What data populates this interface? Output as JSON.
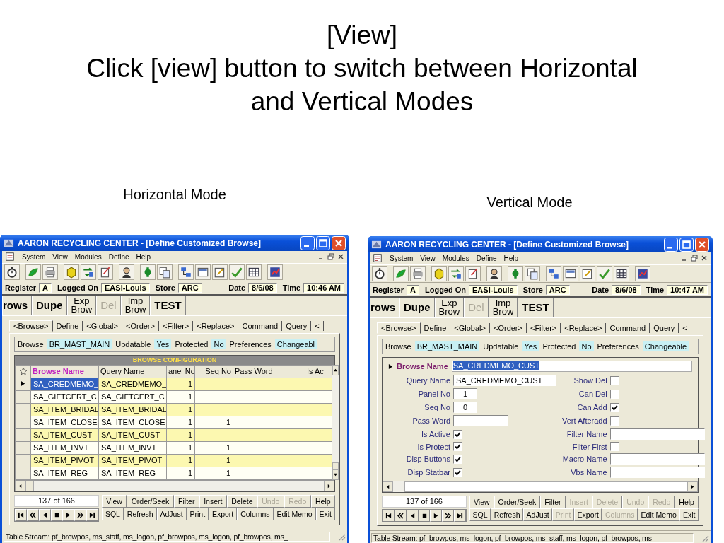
{
  "slide": {
    "title_lines": [
      "[View]",
      "Click [view] button to switch between Horizontal and Vertical Modes"
    ]
  },
  "panels": [
    {
      "caption": "Horizontal Mode",
      "kind": "grid",
      "window": {
        "title": "AARON RECYCLING CENTER - [Define Customized Browse]",
        "menu": [
          "System",
          "View",
          "Modules",
          "Define",
          "Help"
        ],
        "info": [
          {
            "label": "Register",
            "value": "A"
          },
          {
            "label": "Logged On",
            "value": "EASI-Louis"
          },
          {
            "label": "Store",
            "value": "ARC"
          },
          {
            "label": "Date",
            "value": "8/6/08"
          },
          {
            "label": "Time",
            "value": "10:46 AM"
          }
        ],
        "big_buttons": [
          {
            "lines": [
              "rows"
            ],
            "disabled": false
          },
          {
            "lines": [
              "Dupe"
            ],
            "disabled": false
          },
          {
            "lines": [
              "Exp",
              "Brow"
            ],
            "disabled": false
          },
          {
            "lines": [
              "Del"
            ],
            "disabled": true
          },
          {
            "lines": [
              "Imp",
              "Brow"
            ],
            "disabled": false
          },
          {
            "lines": [
              "TEST"
            ],
            "disabled": false
          }
        ],
        "tabs": [
          {
            "label": "<Browse>",
            "selected": true
          },
          {
            "label": "Define",
            "selected": false
          },
          {
            "label": "<Global>",
            "selected": false
          },
          {
            "label": "<Order>",
            "selected": false
          },
          {
            "label": "<Filter>",
            "selected": false
          },
          {
            "label": "<Replace>",
            "selected": false
          },
          {
            "label": "Command",
            "selected": false
          },
          {
            "label": "Query",
            "selected": false
          },
          {
            "label": "<",
            "selected": false
          }
        ],
        "browse_row": [
          {
            "label": "Browse",
            "value": "BR_MAST_MAIN"
          },
          {
            "label": "Updatable",
            "value": "Yes"
          },
          {
            "label": "Protected",
            "value": "No"
          },
          {
            "label": "Preferences",
            "value": "Changeabl"
          }
        ],
        "grid": {
          "band": "BROWSE CONFIGURATION",
          "columns": [
            "Browse Name",
            "Query Name",
            "anel No",
            "Seq No",
            "Pass Word",
            "Is Ac"
          ],
          "rows": [
            {
              "browse_name": "SA_CREDMEMO_",
              "query_name": "SA_CREDMEMO_",
              "panel_no": "1",
              "selected": true
            },
            {
              "browse_name": "SA_GIFTCERT_C",
              "query_name": "SA_GIFTCERT_C",
              "panel_no": "1",
              "selected": false
            },
            {
              "browse_name": "SA_ITEM_BRIDAL",
              "query_name": "SA_ITEM_BRIDAL",
              "panel_no": "1",
              "selected": false
            },
            {
              "browse_name": "SA_ITEM_CLOSE",
              "query_name": "SA_ITEM_CLOSE",
              "panel_no": "1",
              "seq_no": "1",
              "selected": false
            },
            {
              "browse_name": "SA_ITEM_CUST",
              "query_name": "SA_ITEM_CUST",
              "panel_no": "1",
              "selected": false
            },
            {
              "browse_name": "SA_ITEM_INVT",
              "query_name": "SA_ITEM_INVT",
              "panel_no": "1",
              "seq_no": "1",
              "selected": false
            },
            {
              "browse_name": "SA_ITEM_PIVOT",
              "query_name": "SA_ITEM_PIVOT",
              "panel_no": "1",
              "seq_no": "1",
              "selected": false
            },
            {
              "browse_name": "SA_ITEM_REG",
              "query_name": "SA_ITEM_REG",
              "panel_no": "1",
              "seq_no": "1",
              "selected": false
            }
          ]
        },
        "record_count": "137 of 166",
        "button_rows": [
          [
            {
              "label": "View",
              "disabled": false
            },
            {
              "label": "Order/Seek",
              "disabled": false
            },
            {
              "label": "Filter",
              "disabled": false
            },
            {
              "label": "Insert",
              "disabled": false
            },
            {
              "label": "Delete",
              "disabled": false
            },
            {
              "label": "Undo",
              "disabled": true
            },
            {
              "label": "Redo",
              "disabled": true
            },
            {
              "label": "Help",
              "disabled": false
            }
          ],
          [
            {
              "label": "SQL",
              "disabled": false
            },
            {
              "label": "Refresh",
              "disabled": false
            },
            {
              "label": "AdJust",
              "disabled": false
            },
            {
              "label": "Print",
              "disabled": false
            },
            {
              "label": "Export",
              "disabled": false
            },
            {
              "label": "Columns",
              "disabled": false
            },
            {
              "label": "Edit Memo",
              "disabled": false
            },
            {
              "label": "Exit",
              "disabled": false
            }
          ]
        ],
        "status": "Table Stream: pf_browpos, ms_staff, ms_logon, pf_browpos, ms_logon, pf_browpos, ms_"
      }
    },
    {
      "caption": "Vertical Mode",
      "kind": "form",
      "window": {
        "title": "AARON RECYCLING CENTER - [Define Customized Browse]",
        "menu": [
          "System",
          "View",
          "Modules",
          "Define",
          "Help"
        ],
        "info": [
          {
            "label": "Register",
            "value": "A"
          },
          {
            "label": "Logged On",
            "value": "EASI-Louis"
          },
          {
            "label": "Store",
            "value": "ARC"
          },
          {
            "label": "Date",
            "value": "8/6/08"
          },
          {
            "label": "Time",
            "value": "10:47 AM"
          }
        ],
        "big_buttons": [
          {
            "lines": [
              "rows"
            ],
            "disabled": false
          },
          {
            "lines": [
              "Dupe"
            ],
            "disabled": false
          },
          {
            "lines": [
              "Exp",
              "Brow"
            ],
            "disabled": false
          },
          {
            "lines": [
              "Del"
            ],
            "disabled": true
          },
          {
            "lines": [
              "Imp",
              "Brow"
            ],
            "disabled": false
          },
          {
            "lines": [
              "TEST"
            ],
            "disabled": false
          }
        ],
        "tabs": [
          {
            "label": "<Browse>",
            "selected": true
          },
          {
            "label": "Define",
            "selected": false
          },
          {
            "label": "<Global>",
            "selected": false
          },
          {
            "label": "<Order>",
            "selected": false
          },
          {
            "label": "<Filter>",
            "selected": false
          },
          {
            "label": "<Replace>",
            "selected": false
          },
          {
            "label": "Command",
            "selected": false
          },
          {
            "label": "Query",
            "selected": false
          },
          {
            "label": "<",
            "selected": false
          }
        ],
        "browse_row": [
          {
            "label": "Browse",
            "value": "BR_MAST_MAIN"
          },
          {
            "label": "Updatable",
            "value": "Yes"
          },
          {
            "label": "Protected",
            "value": "No"
          },
          {
            "label": "Preferences",
            "value": "Changeable"
          }
        ],
        "form": {
          "key": {
            "label": "Browse Name",
            "value": "SA_CREDMEMO_CUST"
          },
          "left": [
            {
              "kind": "text",
              "label": "Query Name",
              "value": "SA_CREDMEMO_CUST"
            },
            {
              "kind": "number",
              "label": "Panel No",
              "value": "1"
            },
            {
              "kind": "number",
              "label": "Seq No",
              "value": "0"
            },
            {
              "kind": "short",
              "label": "Pass Word"
            },
            {
              "kind": "check",
              "label": "Is Active",
              "checked": true
            },
            {
              "kind": "check",
              "label": "Is Protect",
              "checked": true
            },
            {
              "kind": "check",
              "label": "Disp Buttons",
              "checked": true
            },
            {
              "kind": "check",
              "label": "Disp Statbar",
              "checked": true
            }
          ],
          "right": [
            {
              "kind": "check",
              "label": "Show Del",
              "checked": false
            },
            {
              "kind": "check",
              "label": "Can Del",
              "checked": false
            },
            {
              "kind": "check",
              "label": "Can Add",
              "checked": true
            },
            {
              "kind": "check",
              "label": "Vert Afteradd",
              "checked": false
            },
            {
              "kind": "text",
              "label": "Filter Name"
            },
            {
              "kind": "check",
              "label": "Filter First",
              "checked": false
            },
            {
              "kind": "text",
              "label": "Macro Name"
            },
            {
              "kind": "text",
              "label": "Vbs Name"
            }
          ]
        },
        "record_count": "137 of 166",
        "button_rows": [
          [
            {
              "label": "View",
              "disabled": false
            },
            {
              "label": "Order/Seek",
              "disabled": false
            },
            {
              "label": "Filter",
              "disabled": false
            },
            {
              "label": "Insert",
              "disabled": true
            },
            {
              "label": "Delete",
              "disabled": true
            },
            {
              "label": "Undo",
              "disabled": true
            },
            {
              "label": "Redo",
              "disabled": true
            },
            {
              "label": "Help",
              "disabled": false
            }
          ],
          [
            {
              "label": "SQL",
              "disabled": false
            },
            {
              "label": "Refresh",
              "disabled": false
            },
            {
              "label": "AdJust",
              "disabled": false
            },
            {
              "label": "Print",
              "disabled": true
            },
            {
              "label": "Export",
              "disabled": false
            },
            {
              "label": "Columns",
              "disabled": true
            },
            {
              "label": "Edit Memo",
              "disabled": false
            },
            {
              "label": "Exit",
              "disabled": false
            }
          ]
        ],
        "status": "Table Stream: pf_browpos, ms_logon, pf_browpos, ms_staff, ms_logon, pf_browpos, ms_"
      }
    }
  ]
}
